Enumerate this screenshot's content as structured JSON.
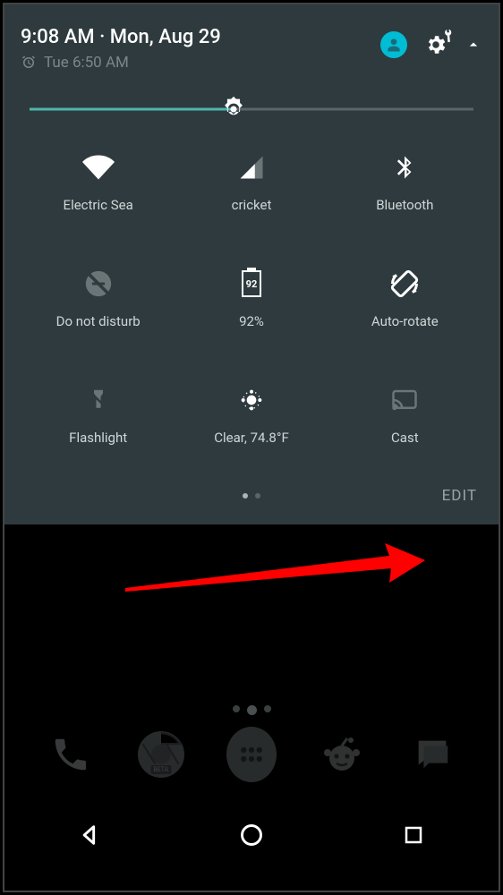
{
  "header": {
    "time": "9:08 AM",
    "date_separator": " · ",
    "date": "Mon, Aug 29",
    "alarm": "Tue 6:50 AM"
  },
  "brightness": {
    "percent": 46
  },
  "tiles": [
    {
      "icon": "wifi-icon",
      "label": "Electric Sea",
      "active": true
    },
    {
      "icon": "signal-icon",
      "label": "cricket",
      "active": true
    },
    {
      "icon": "bluetooth-icon",
      "label": "Bluetooth",
      "active": true
    },
    {
      "icon": "dnd-off-icon",
      "label": "Do not disturb",
      "active": false
    },
    {
      "icon": "battery-icon",
      "label": "92%",
      "badge": "92",
      "active": true
    },
    {
      "icon": "auto-rotate-icon",
      "label": "Auto-rotate",
      "active": true
    },
    {
      "icon": "flashlight-off-icon",
      "label": "Flashlight",
      "active": false
    },
    {
      "icon": "weather-icon",
      "label": "Clear, 74.8°F",
      "active": true
    },
    {
      "icon": "cast-icon",
      "label": "Cast",
      "active": false
    }
  ],
  "footer": {
    "edit_label": "EDIT"
  },
  "dock": {
    "items": [
      "phone",
      "chrome-beta",
      "app-drawer",
      "reddit",
      "messenger"
    ]
  },
  "nav": {
    "back": "back",
    "home": "home",
    "recent": "recent"
  }
}
